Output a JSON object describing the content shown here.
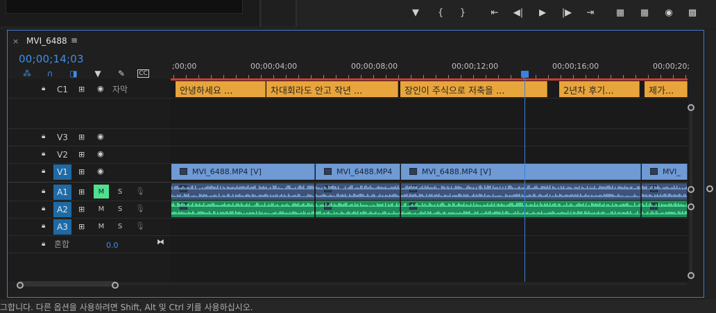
{
  "sequence": {
    "tab_name": "MVI_6488",
    "timecode": "00;00;14;03"
  },
  "transport": [
    "marker-icon",
    "mark-in-icon",
    "mark-out-icon",
    "go-to-in-icon",
    "step-back-icon",
    "play-icon",
    "step-forward-icon",
    "go-to-out-icon",
    "lift-icon",
    "extract-icon",
    "export-frame-icon",
    "button-editor-icon"
  ],
  "ruler": {
    "labels": [
      ";00;00",
      "00;00;04;00",
      "00;00;08;00",
      "00;00;12;00",
      "00;00;16;00",
      "00;00;20;"
    ]
  },
  "tracks": {
    "c1": {
      "name": "C1",
      "label": "자막"
    },
    "v3": {
      "name": "V3"
    },
    "v2": {
      "name": "V2"
    },
    "v1": {
      "name": "V1"
    },
    "a1": {
      "name": "A1",
      "m": "M",
      "s": "S"
    },
    "a2": {
      "name": "A2",
      "m": "M",
      "s": "S"
    },
    "a3": {
      "name": "A3",
      "m": "M",
      "s": "S"
    },
    "mix": {
      "label": "혼합",
      "value": "0.0"
    }
  },
  "captions": [
    "안녕하세요 ...",
    "차대회라도 안고 작년 ...",
    "장인이 주식으로 저축을 ...",
    "2년차 후기...",
    "제가..."
  ],
  "video_clips": [
    "MVI_6488.MP4 [V]",
    "MVI_6488.MP4",
    "MVI_6488.MP4 [V]",
    "MVI_"
  ],
  "status_text": "그합니다. 다른 옵션을 사용하려면 Shift, Alt 및 Ctrl 키를 사용하십시오.",
  "colors": {
    "accent": "#3d8fea",
    "caption": "#e8a53c",
    "video_clip": "#6f9ad4",
    "audio_a1": "#4f6ea3",
    "audio_a2": "#3fbf7f",
    "mute_on": "#4fe08f"
  }
}
